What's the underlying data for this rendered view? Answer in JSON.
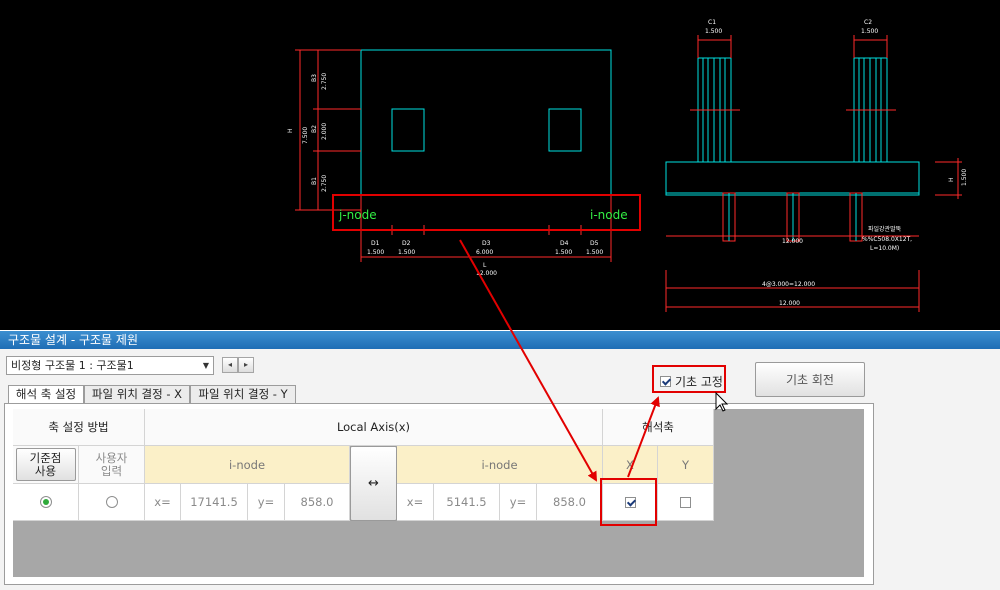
{
  "cad": {
    "nodes": {
      "j": "j-node",
      "i": "i-node"
    },
    "plan_labels": {
      "h_total": "H",
      "h_total_val": "7.500",
      "b3": "B3",
      "b3_val": "2.750",
      "b2": "B2",
      "b2_val": "2.000",
      "b1": "B1",
      "b1_val": "2.750",
      "d_labels": [
        "D1",
        "D2",
        "D3",
        "D4",
        "D5"
      ],
      "d_vals": [
        "1.500",
        "1.500",
        "6.000",
        "1.500",
        "1.500"
      ],
      "l_label": "L",
      "l_val": "12.000"
    },
    "section_labels": {
      "c1": "C1",
      "c1_val": "1.500",
      "c2": "C2",
      "c2_val": "1.500",
      "h": "H",
      "h_val": "1.500",
      "pile_dim": "12.000",
      "pile_note1": "파일강관말뚝",
      "pile_note2": "%%C508.0X12T,",
      "pile_note3": "L=10.0M)",
      "spacing": "4@3.000=12.000",
      "total": "12.000"
    }
  },
  "window": {
    "title": "구조물 설계 - 구조물 제원"
  },
  "structure_select": {
    "value": "비정형 구조물 1 : 구조물1"
  },
  "nav": {
    "prev": "◂",
    "next": "▸"
  },
  "fix_checkbox": {
    "label": "기초 고정",
    "checked": true
  },
  "rotate_button": {
    "label": "기초 회전"
  },
  "tabs": [
    {
      "label": "해석 축 설정",
      "active": true
    },
    {
      "label": "파일 위치 결정 - X",
      "active": false
    },
    {
      "label": "파일 위치 결정 - Y",
      "active": false
    }
  ],
  "grid": {
    "method_header": "축 설정 방법",
    "local_axis_header": "Local Axis(x)",
    "analysis_axis_header": "해석축",
    "base_point_button": "기준점\n사용",
    "user_input_label": "사용자\n입력",
    "i_node_label": "i-node",
    "i_node_label_2": "i-node",
    "swap_button": "↔",
    "axis_x": "X",
    "axis_y": "Y",
    "row": {
      "base_point_selected": true,
      "user_input_selected": false,
      "x_label": "x=",
      "x1": "17141.5",
      "y_label": "y=",
      "y1": "858.0",
      "x2_label": "x=",
      "x2": "5141.5",
      "y2_label": "y=",
      "y2": "858.0",
      "analysis_x": true,
      "analysis_y": false
    }
  },
  "colors": {
    "cad_bg": "#000000",
    "cad_line": "#00e5e5",
    "dim_line": "#ff2a2a",
    "annot_red": "#e20000",
    "title_blue": "#2a7cc4",
    "grid_yellow": "#fbf0c8"
  }
}
